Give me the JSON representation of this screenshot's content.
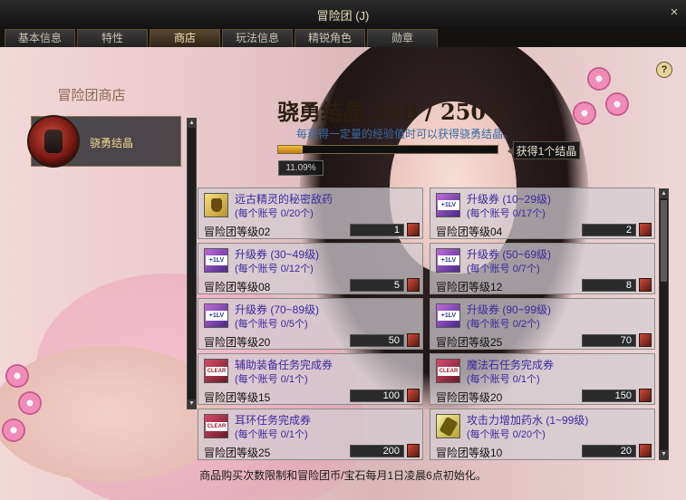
{
  "window": {
    "title": "冒险团 (J)",
    "close_glyph": "×"
  },
  "tabs": [
    {
      "label": "基本信息",
      "active": false
    },
    {
      "label": "特性",
      "active": false
    },
    {
      "label": "商店",
      "active": true
    },
    {
      "label": "玩法信息",
      "active": false
    },
    {
      "label": "精锐角色",
      "active": false
    },
    {
      "label": "勋章",
      "active": false
    }
  ],
  "help_glyph": "?",
  "sidebar": {
    "title": "冒险团商店",
    "category": {
      "label": "骁勇结晶",
      "icon": "fist-emblem-icon"
    }
  },
  "currency": {
    "name": "骁勇结晶",
    "current": "250",
    "separator": "/",
    "max": "250",
    "unit": "个",
    "hint": "每获得一定量的经验值时可以获得骁勇结晶。",
    "progress_fraction": 0.1109,
    "progress_percent_label": "11.09%",
    "reward_badge": "获得1个结晶"
  },
  "items": [
    {
      "name": "远古精灵的秘密敌药",
      "limit": "(每个账号 0/20个)",
      "level": "冒险团等级02",
      "price": "1",
      "icon": "potion-icon"
    },
    {
      "name": "升级券 (10~29级)",
      "limit": "(每个账号 0/17个)",
      "level": "冒险团等级04",
      "price": "2",
      "icon": "level-up-ticket-icon"
    },
    {
      "name": "升级券 (30~49级)",
      "limit": "(每个账号 0/12个)",
      "level": "冒险团等级08",
      "price": "5",
      "icon": "level-up-ticket-icon"
    },
    {
      "name": "升级券 (50~69级)",
      "limit": "(每个账号 0/7个)",
      "level": "冒险团等级12",
      "price": "8",
      "icon": "level-up-ticket-icon"
    },
    {
      "name": "升级券 (70~89级)",
      "limit": "(每个账号 0/5个)",
      "level": "冒险团等级20",
      "price": "50",
      "icon": "level-up-ticket-icon"
    },
    {
      "name": "升级券 (90~99级)",
      "limit": "(每个账号 0/2个)",
      "level": "冒险团等级25",
      "price": "70",
      "icon": "level-up-ticket-icon"
    },
    {
      "name": "辅助装备任务完成券",
      "limit": "(每个账号 0/1个)",
      "level": "冒险团等级15",
      "price": "100",
      "icon": "clear-ticket-icon"
    },
    {
      "name": "魔法石任务完成券",
      "limit": "(每个账号 0/1个)",
      "level": "冒险团等级20",
      "price": "150",
      "icon": "clear-ticket-icon"
    },
    {
      "name": "耳环任务完成券",
      "limit": "(每个账号 0/1个)",
      "level": "冒险团等级25",
      "price": "200",
      "icon": "clear-ticket-icon"
    },
    {
      "name": "攻击力增加药水 (1~99级)",
      "limit": "(每个账号 0/20个)",
      "level": "冒险团等级10",
      "price": "20",
      "icon": "potion-icon"
    }
  ],
  "footer": "商品购买次数限制和冒险团币/宝石每月1日凌晨6点初始化。"
}
